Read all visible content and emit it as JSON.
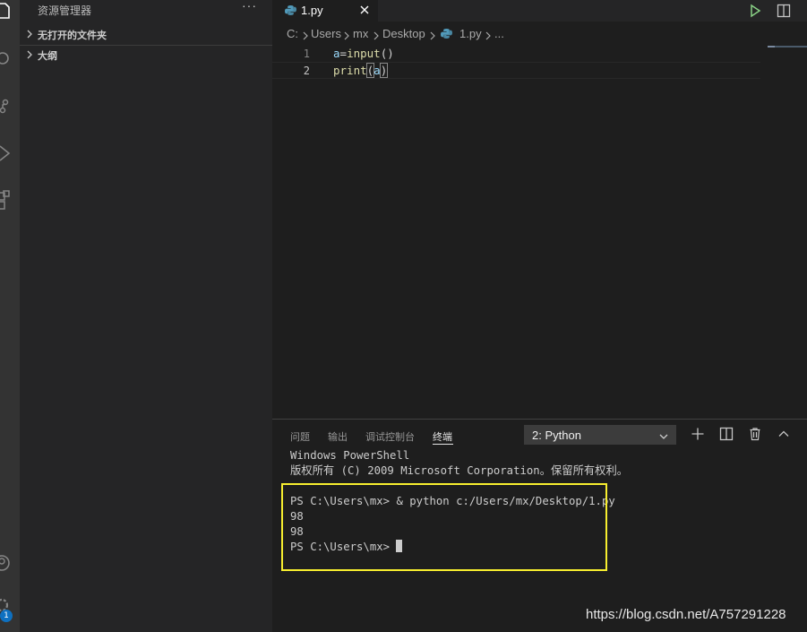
{
  "activity_bar": {
    "icons": [
      "files-icon",
      "search-icon",
      "source-control-icon",
      "run-icon",
      "extensions-icon",
      "account-icon",
      "settings-icon"
    ],
    "settings_badge": "1"
  },
  "sidebar": {
    "title": "资源管理器",
    "more": "···",
    "sections": [
      {
        "label": "无打开的文件夹"
      },
      {
        "label": "大纲"
      }
    ]
  },
  "tabs": [
    {
      "label": "1.py",
      "active": true
    }
  ],
  "breadcrumb": [
    "C:",
    "Users",
    "mx",
    "Desktop",
    "1.py",
    "..."
  ],
  "editor": {
    "lines": [
      {
        "number": "1",
        "text": "a=input()"
      },
      {
        "number": "2",
        "text": "print(a)"
      }
    ]
  },
  "panel": {
    "tabs": [
      "问题",
      "输出",
      "调试控制台",
      "终端"
    ],
    "active_tab": "终端",
    "terminal_selector": "2: Python",
    "terminal_lines": [
      "Windows PowerShell",
      "版权所有 (C) 2009 Microsoft Corporation。保留所有权利。",
      "",
      "PS C:\\Users\\mx> & python c:/Users/mx/Desktop/1.py",
      "98",
      "98",
      "PS C:\\Users\\mx> "
    ]
  },
  "watermark": "https://blog.csdn.net/A757291228",
  "colors": {
    "highlight_box": "#f7ee2f",
    "python_icon": "#519aba",
    "run_button": "#89d185",
    "badge": "#0e70c0"
  }
}
